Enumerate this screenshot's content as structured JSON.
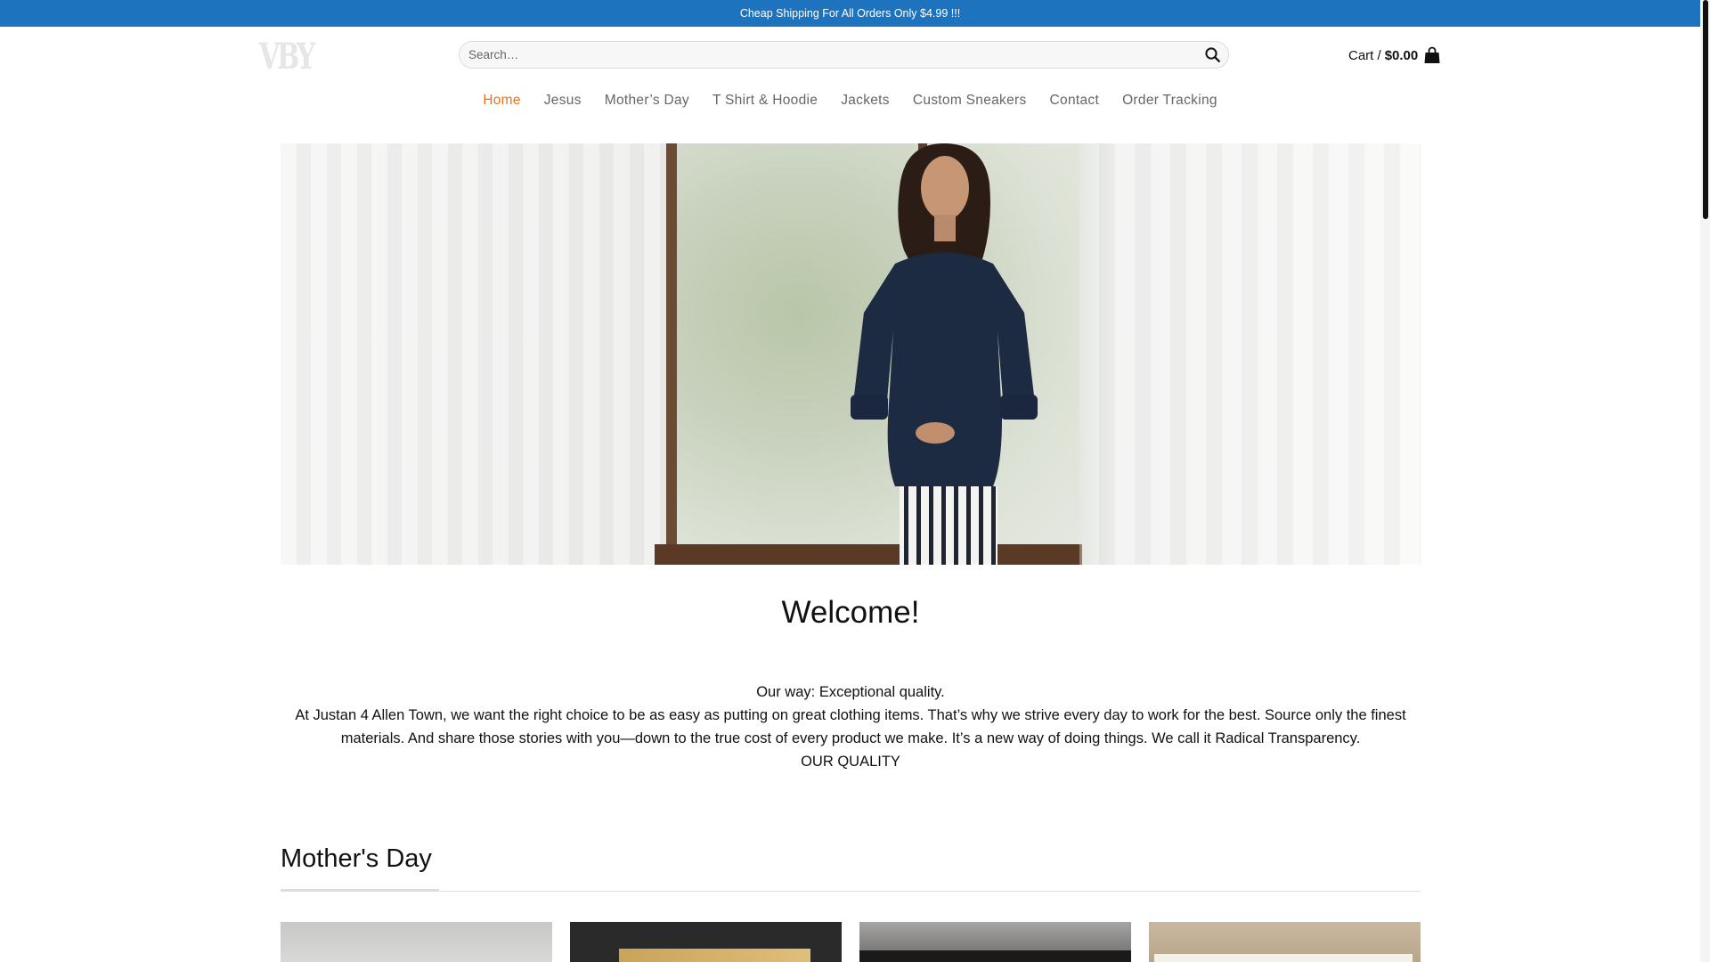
{
  "announcement": "Cheap Shipping For All Orders Only $4.99 !!!",
  "logo": {
    "text": "VBY"
  },
  "search": {
    "placeholder": "Search…",
    "value": ""
  },
  "cart": {
    "label": "Cart /",
    "amount": "$0.00"
  },
  "nav": {
    "items": [
      {
        "label": "Home",
        "active": true
      },
      {
        "label": "Jesus"
      },
      {
        "label": "Mother’s Day"
      },
      {
        "label": "T Shirt & Hoodie"
      },
      {
        "label": "Jackets"
      },
      {
        "label": "Custom Sneakers"
      },
      {
        "label": "Contact"
      },
      {
        "label": "Order Tracking"
      }
    ]
  },
  "welcome": {
    "title": "Welcome!",
    "line1": "Our way: Exceptional quality.",
    "line2": "At Justan 4 Allen Town, we want the right choice to be as easy as putting on great clothing items. That’s why we strive every day to work for the best. Source only the finest materials. And share those stories with you—down to the true cost of every product we make. It’s a new way of doing things. We call it Radical Transparency.",
    "line3": "OUR QUALITY"
  },
  "section": {
    "title": "Mother's Day"
  },
  "colors": {
    "accent": "#e8731c",
    "topbar": "#1e73be"
  }
}
